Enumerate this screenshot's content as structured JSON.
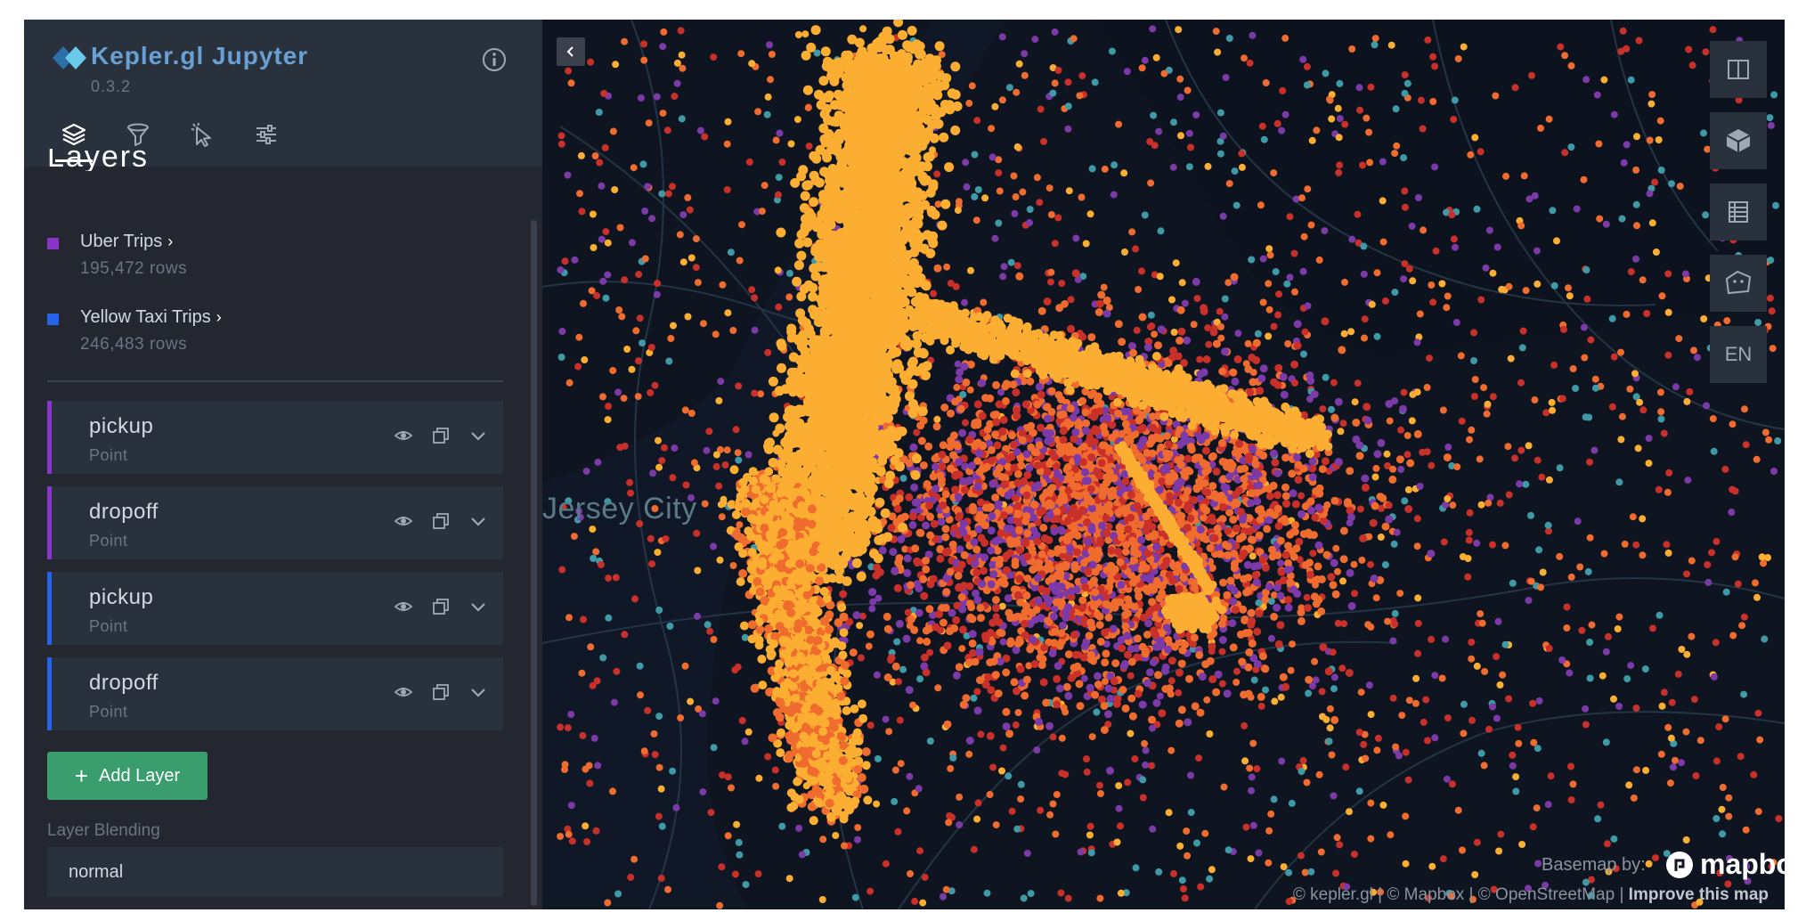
{
  "app": {
    "title": "Kepler.gl Jupyter",
    "version": "0.3.2"
  },
  "tabs": [
    {
      "name": "layers",
      "icon": "layers-icon",
      "active": true
    },
    {
      "name": "filters",
      "icon": "filter-icon",
      "active": false
    },
    {
      "name": "interactions",
      "icon": "cursor-icon",
      "active": false
    },
    {
      "name": "map-style",
      "icon": "settings-sliders-icon",
      "active": false
    }
  ],
  "panel": {
    "heading": "Layers"
  },
  "datasets": [
    {
      "name": "Uber Trips",
      "rows": "195,472 rows",
      "color": "#8a34c9"
    },
    {
      "name": "Yellow Taxi Trips",
      "rows": "246,483 rows",
      "color": "#2563eb"
    }
  ],
  "layers": [
    {
      "name": "pickup",
      "type": "Point",
      "color": "#8a34c9"
    },
    {
      "name": "dropoff",
      "type": "Point",
      "color": "#8a34c9"
    },
    {
      "name": "pickup",
      "type": "Point",
      "color": "#2563eb"
    },
    {
      "name": "dropoff",
      "type": "Point",
      "color": "#2563eb"
    }
  ],
  "add_layer": {
    "label": "Add Layer"
  },
  "blending": {
    "label": "Layer Blending",
    "value": "normal"
  },
  "map": {
    "city_label": "Jersey City",
    "controls": [
      "split-map-icon",
      "3d-view-icon",
      "data-table-icon",
      "draw-polygon-icon"
    ],
    "locale_button": "EN",
    "basemap_by": "Basemap by:",
    "mapbox_wordmark": "mapbox",
    "attribution": "© kepler.gl | © Mapbox | © OpenStreetMap | ",
    "improve_link": "Improve this map"
  },
  "colors": {
    "sidebar_bg": "#242730",
    "panel_bg": "#29323c",
    "map_bg": "#0e1521",
    "accent_green": "#3a9d6e",
    "point_yellow": "#fbae32",
    "point_orange": "#f06b2e",
    "point_red": "#c9302a",
    "point_purple": "#7c3aa8",
    "point_teal": "#3f9aa8"
  }
}
